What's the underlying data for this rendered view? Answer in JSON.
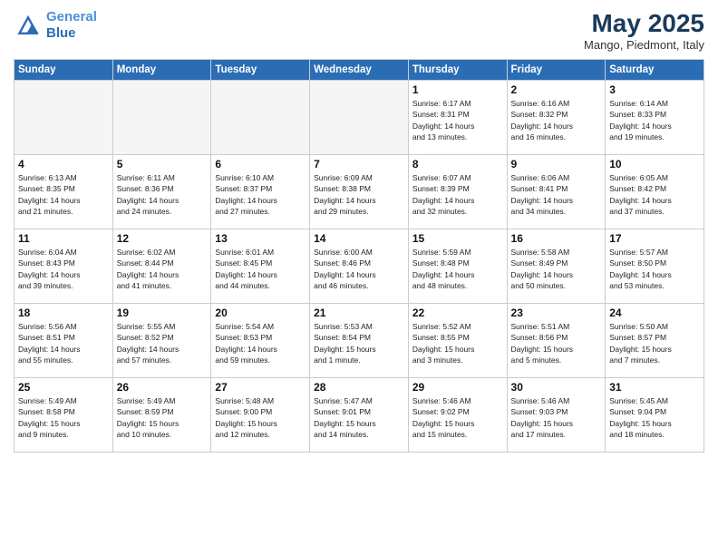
{
  "header": {
    "logo_line1": "General",
    "logo_line2": "Blue",
    "month": "May 2025",
    "location": "Mango, Piedmont, Italy"
  },
  "weekdays": [
    "Sunday",
    "Monday",
    "Tuesday",
    "Wednesday",
    "Thursday",
    "Friday",
    "Saturday"
  ],
  "weeks": [
    [
      {
        "day": "",
        "info": ""
      },
      {
        "day": "",
        "info": ""
      },
      {
        "day": "",
        "info": ""
      },
      {
        "day": "",
        "info": ""
      },
      {
        "day": "1",
        "info": "Sunrise: 6:17 AM\nSunset: 8:31 PM\nDaylight: 14 hours\nand 13 minutes."
      },
      {
        "day": "2",
        "info": "Sunrise: 6:16 AM\nSunset: 8:32 PM\nDaylight: 14 hours\nand 16 minutes."
      },
      {
        "day": "3",
        "info": "Sunrise: 6:14 AM\nSunset: 8:33 PM\nDaylight: 14 hours\nand 19 minutes."
      }
    ],
    [
      {
        "day": "4",
        "info": "Sunrise: 6:13 AM\nSunset: 8:35 PM\nDaylight: 14 hours\nand 21 minutes."
      },
      {
        "day": "5",
        "info": "Sunrise: 6:11 AM\nSunset: 8:36 PM\nDaylight: 14 hours\nand 24 minutes."
      },
      {
        "day": "6",
        "info": "Sunrise: 6:10 AM\nSunset: 8:37 PM\nDaylight: 14 hours\nand 27 minutes."
      },
      {
        "day": "7",
        "info": "Sunrise: 6:09 AM\nSunset: 8:38 PM\nDaylight: 14 hours\nand 29 minutes."
      },
      {
        "day": "8",
        "info": "Sunrise: 6:07 AM\nSunset: 8:39 PM\nDaylight: 14 hours\nand 32 minutes."
      },
      {
        "day": "9",
        "info": "Sunrise: 6:06 AM\nSunset: 8:41 PM\nDaylight: 14 hours\nand 34 minutes."
      },
      {
        "day": "10",
        "info": "Sunrise: 6:05 AM\nSunset: 8:42 PM\nDaylight: 14 hours\nand 37 minutes."
      }
    ],
    [
      {
        "day": "11",
        "info": "Sunrise: 6:04 AM\nSunset: 8:43 PM\nDaylight: 14 hours\nand 39 minutes."
      },
      {
        "day": "12",
        "info": "Sunrise: 6:02 AM\nSunset: 8:44 PM\nDaylight: 14 hours\nand 41 minutes."
      },
      {
        "day": "13",
        "info": "Sunrise: 6:01 AM\nSunset: 8:45 PM\nDaylight: 14 hours\nand 44 minutes."
      },
      {
        "day": "14",
        "info": "Sunrise: 6:00 AM\nSunset: 8:46 PM\nDaylight: 14 hours\nand 46 minutes."
      },
      {
        "day": "15",
        "info": "Sunrise: 5:59 AM\nSunset: 8:48 PM\nDaylight: 14 hours\nand 48 minutes."
      },
      {
        "day": "16",
        "info": "Sunrise: 5:58 AM\nSunset: 8:49 PM\nDaylight: 14 hours\nand 50 minutes."
      },
      {
        "day": "17",
        "info": "Sunrise: 5:57 AM\nSunset: 8:50 PM\nDaylight: 14 hours\nand 53 minutes."
      }
    ],
    [
      {
        "day": "18",
        "info": "Sunrise: 5:56 AM\nSunset: 8:51 PM\nDaylight: 14 hours\nand 55 minutes."
      },
      {
        "day": "19",
        "info": "Sunrise: 5:55 AM\nSunset: 8:52 PM\nDaylight: 14 hours\nand 57 minutes."
      },
      {
        "day": "20",
        "info": "Sunrise: 5:54 AM\nSunset: 8:53 PM\nDaylight: 14 hours\nand 59 minutes."
      },
      {
        "day": "21",
        "info": "Sunrise: 5:53 AM\nSunset: 8:54 PM\nDaylight: 15 hours\nand 1 minute."
      },
      {
        "day": "22",
        "info": "Sunrise: 5:52 AM\nSunset: 8:55 PM\nDaylight: 15 hours\nand 3 minutes."
      },
      {
        "day": "23",
        "info": "Sunrise: 5:51 AM\nSunset: 8:56 PM\nDaylight: 15 hours\nand 5 minutes."
      },
      {
        "day": "24",
        "info": "Sunrise: 5:50 AM\nSunset: 8:57 PM\nDaylight: 15 hours\nand 7 minutes."
      }
    ],
    [
      {
        "day": "25",
        "info": "Sunrise: 5:49 AM\nSunset: 8:58 PM\nDaylight: 15 hours\nand 9 minutes."
      },
      {
        "day": "26",
        "info": "Sunrise: 5:49 AM\nSunset: 8:59 PM\nDaylight: 15 hours\nand 10 minutes."
      },
      {
        "day": "27",
        "info": "Sunrise: 5:48 AM\nSunset: 9:00 PM\nDaylight: 15 hours\nand 12 minutes."
      },
      {
        "day": "28",
        "info": "Sunrise: 5:47 AM\nSunset: 9:01 PM\nDaylight: 15 hours\nand 14 minutes."
      },
      {
        "day": "29",
        "info": "Sunrise: 5:46 AM\nSunset: 9:02 PM\nDaylight: 15 hours\nand 15 minutes."
      },
      {
        "day": "30",
        "info": "Sunrise: 5:46 AM\nSunset: 9:03 PM\nDaylight: 15 hours\nand 17 minutes."
      },
      {
        "day": "31",
        "info": "Sunrise: 5:45 AM\nSunset: 9:04 PM\nDaylight: 15 hours\nand 18 minutes."
      }
    ]
  ]
}
